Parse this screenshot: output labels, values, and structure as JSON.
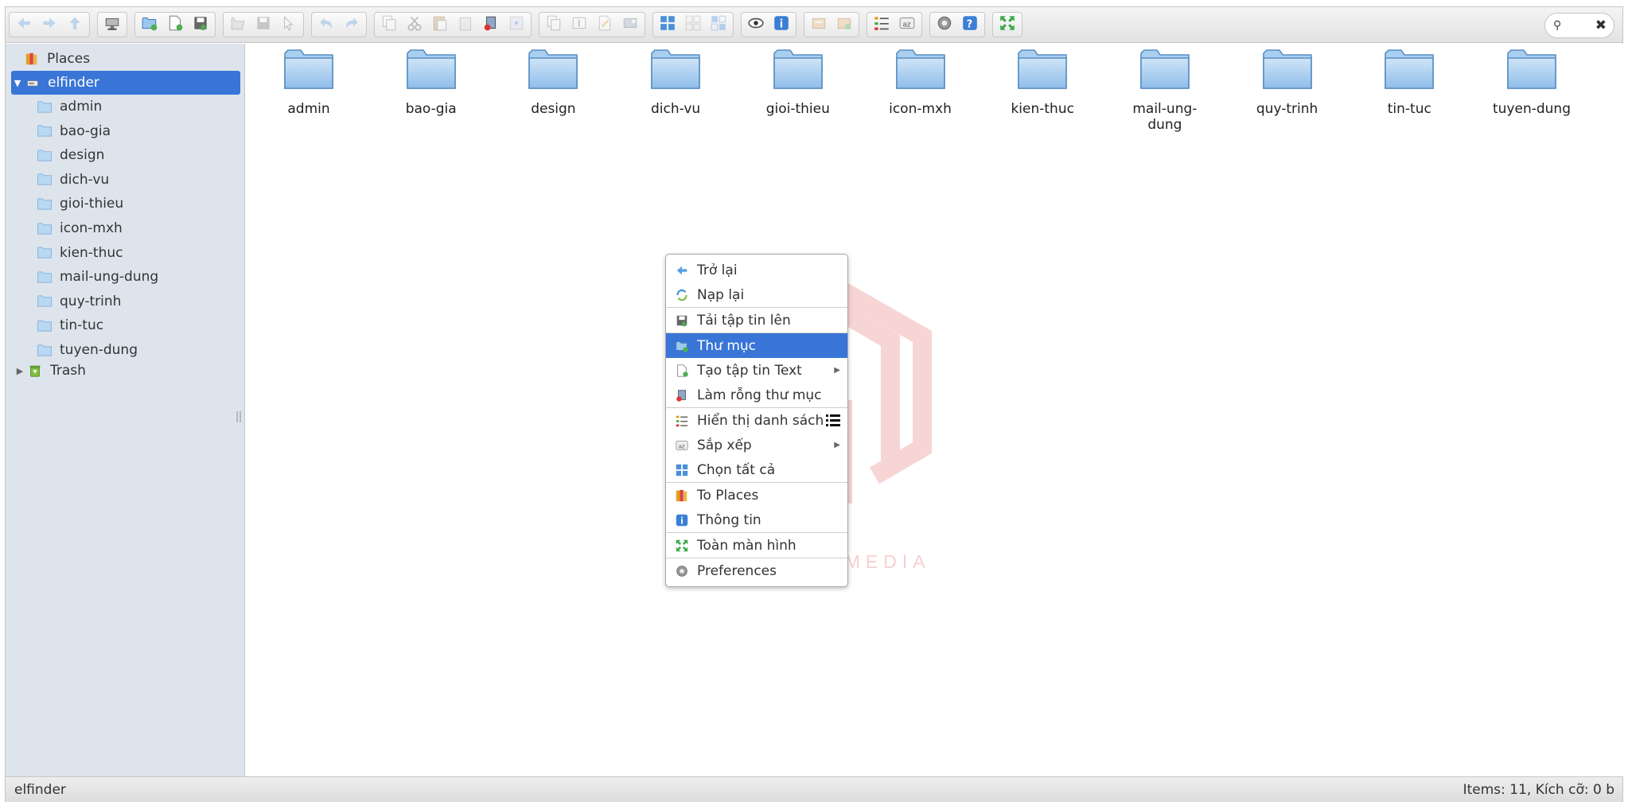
{
  "colors": {
    "accent": "#3875d7",
    "nav_bg": "#dde4ec",
    "folder": "#8fbde9",
    "watermark": "#f6d0d0"
  },
  "toolbar": {
    "groups": [
      [
        "back-icon",
        "forward-icon",
        "up-icon"
      ],
      [
        "home-icon"
      ],
      [
        "mkdir-icon",
        "mkfile-icon",
        "upload-icon"
      ],
      [
        "open-icon",
        "download-icon",
        "getfile-icon"
      ],
      [
        "undo-icon",
        "redo-icon"
      ],
      [
        "copy-icon",
        "cut-icon",
        "paste-icon",
        "rm-icon",
        "empty-icon",
        "hide-icon"
      ],
      [
        "duplicate-icon",
        "rename-icon",
        "edit-icon",
        "resize-icon"
      ],
      [
        "selectall-icon",
        "selectnone-icon",
        "selectinvert-icon"
      ],
      [
        "quicklook-icon",
        "info-icon"
      ],
      [
        "extract-icon",
        "archive-icon"
      ],
      [
        "view-icon",
        "sort-icon"
      ],
      [
        "preferences-icon",
        "help-icon"
      ],
      [
        "fullscreen-icon"
      ]
    ]
  },
  "search": {
    "icon": "search-icon",
    "clear": "✖"
  },
  "nav": {
    "places": "Places",
    "root": "elfinder",
    "folders": [
      "admin",
      "bao-gia",
      "design",
      "dich-vu",
      "gioi-thieu",
      "icon-mxh",
      "kien-thuc",
      "mail-ung-dung",
      "quy-trinh",
      "tin-tuc",
      "tuyen-dung"
    ],
    "trash": "Trash"
  },
  "files": [
    "admin",
    "bao-gia",
    "design",
    "dich-vu",
    "gioi-thieu",
    "icon-mxh",
    "kien-thuc",
    "mail-ung-dung",
    "quy-trinh",
    "tin-tuc",
    "tuyen-dung"
  ],
  "watermark": {
    "text": "NGỌC PHÚ MEDIA"
  },
  "context_menu": {
    "items": [
      {
        "label": "Trở lại",
        "icon": "back-icon"
      },
      {
        "label": "Nạp lại",
        "icon": "reload-icon"
      },
      {
        "label": "Tải tập tin lên",
        "icon": "upload-icon"
      },
      {
        "label": "Thư mục",
        "icon": "new-folder-icon",
        "highlighted": true
      },
      {
        "label": "Tạo tập tin Text",
        "icon": "new-file-icon",
        "submenu": true
      },
      {
        "label": "Làm rỗng thư mục",
        "icon": "empty-folder-icon"
      },
      {
        "label": "Hiển thị danh sách",
        "icon": "list-view-icon"
      },
      {
        "label": "Sắp xếp",
        "icon": "sort-icon",
        "submenu": true
      },
      {
        "label": "Chọn tất cả",
        "icon": "select-all-icon"
      },
      {
        "label": "To Places",
        "icon": "places-icon"
      },
      {
        "label": "Thông tin",
        "icon": "info-icon"
      },
      {
        "label": "Toàn màn hình",
        "icon": "fullscreen-icon"
      },
      {
        "label": "Preferences",
        "icon": "preferences-icon"
      }
    ]
  },
  "status": {
    "path": "elfinder",
    "summary": "Items: 11, Kích cỡ: 0 b"
  }
}
